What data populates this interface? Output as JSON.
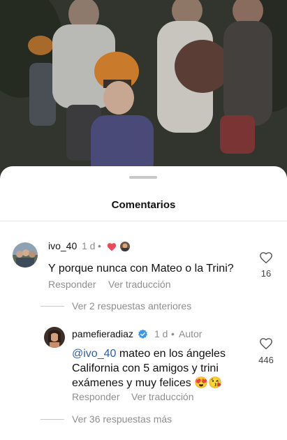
{
  "sheet": {
    "title": "Comentarios"
  },
  "comments": [
    {
      "username": "ivo_40",
      "time": "1 d",
      "text": "Y porque nunca con Mateo o la Trini?",
      "like_count": "16",
      "reply_label": "Responder",
      "translate_label": "Ver traducción",
      "view_replies_label": "Ver 2 respuestas anteriores"
    },
    {
      "username": "pamefieradiaz",
      "time": "1 d",
      "author_tag": "Autor",
      "mention": "@ivo_40",
      "text_line1": " mateo en los ángeles",
      "text_line2": "California con 5 amigos y trini",
      "text_line3": "exámenes y muy felices ",
      "emoji": "😍😘",
      "like_count": "446",
      "reply_label": "Responder",
      "translate_label": "Ver traducción",
      "more_replies_label": "Ver 36 respuestas más"
    }
  ],
  "colors": {
    "accent_link": "#2e5ea7",
    "verified_blue": "#3897f0",
    "heart_red": "#ed4956",
    "muted_text": "#8e8e8e"
  },
  "icons": {
    "like": "heart-outline-icon",
    "liked_by_author": "heart-filled-icon",
    "verified": "verified-badge-icon"
  }
}
